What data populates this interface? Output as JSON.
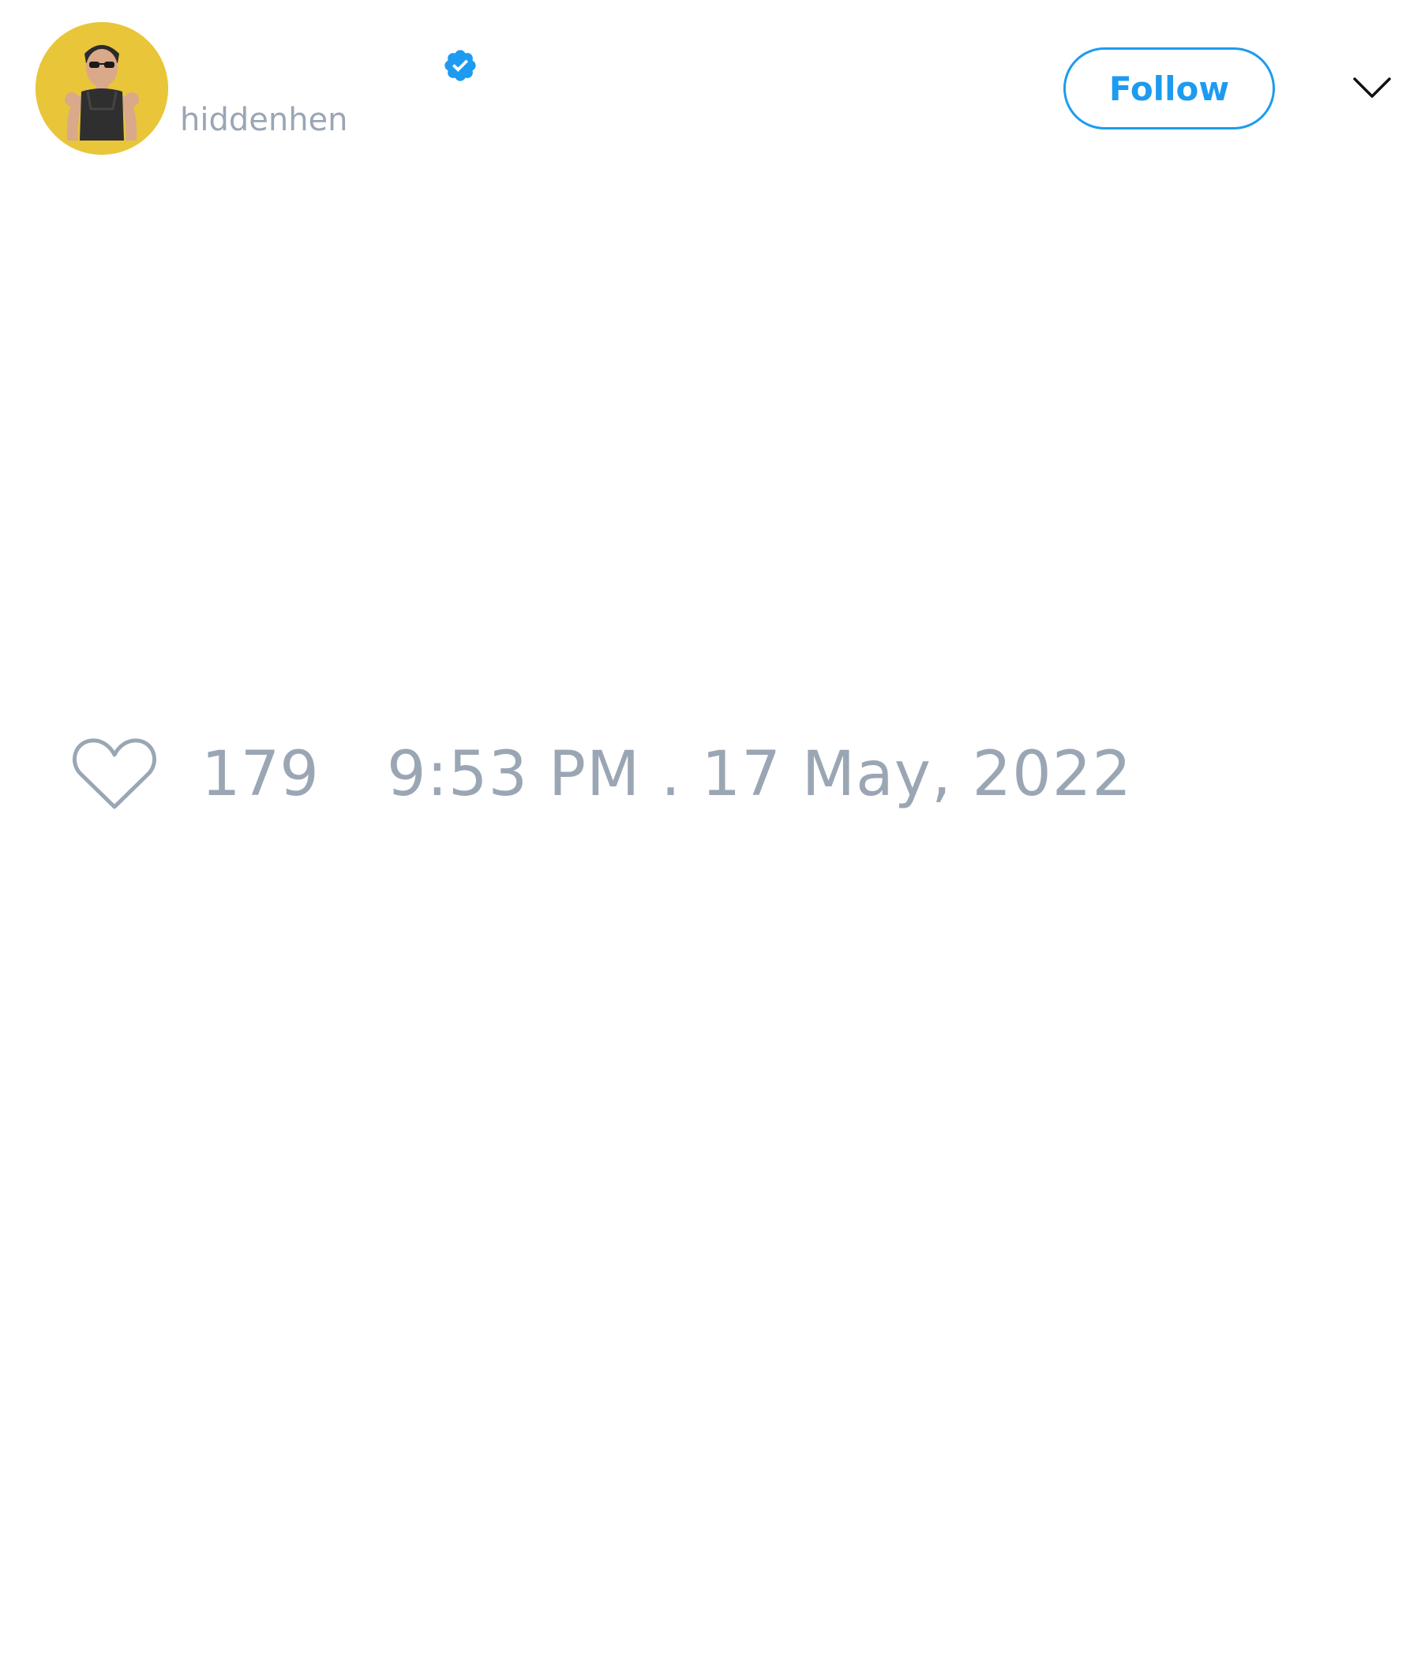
{
  "tweet": {
    "author": {
      "handle": "hiddenhen",
      "verified": true,
      "avatar_icon": "avatar-portrait",
      "avatar_bg": "#e9c53a"
    },
    "follow_label": "Follow",
    "menu_icon": "chevron-down-icon",
    "like_icon": "heart-icon",
    "likes": "179",
    "timestamp": "9:53 PM . 17 May, 2022"
  },
  "colors": {
    "accent": "#1d9bf0",
    "muted_text": "#9aa6b4"
  }
}
